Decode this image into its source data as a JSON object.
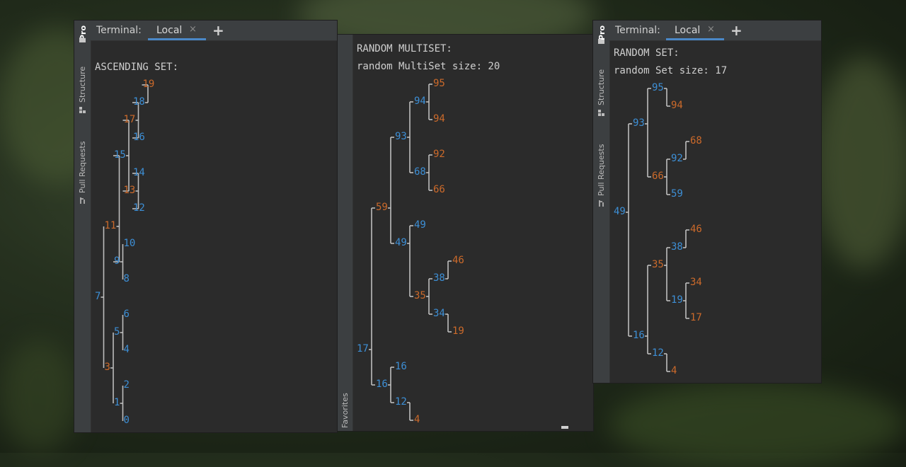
{
  "colors": {
    "orange": "#cc6a2b",
    "blue": "#3d8fd6",
    "text": "#cfcfcf",
    "panel": "#2b2b2b",
    "tabbar": "#3c3f41",
    "accent": "#4a88c7"
  },
  "sidebar": {
    "project": "Pro",
    "structure": "Structure",
    "pull_requests": "Pull Requests",
    "favorites": "Favorites"
  },
  "terminal": {
    "title": "Terminal:",
    "tab_label": "Local",
    "close_glyph": "×",
    "add_glyph": "+"
  },
  "panels": {
    "ascending": {
      "header": "ASCENDING SET:"
    },
    "multiset": {
      "header": "RANDOM MULTISET:",
      "size_line": "random MultiSet size: 20"
    },
    "randomset": {
      "header": "RANDOM SET:",
      "size_line": "random Set size: 17"
    }
  },
  "trees": {
    "ascending": {
      "v": 7,
      "c": "b",
      "L": {
        "v": 3,
        "c": "o",
        "L": {
          "v": 1,
          "c": "b",
          "L": {
            "v": 0,
            "c": "b"
          },
          "R": {
            "v": 2,
            "c": "b"
          }
        },
        "R": {
          "v": 5,
          "c": "b",
          "L": {
            "v": 4,
            "c": "b"
          },
          "R": {
            "v": 6,
            "c": "b"
          }
        }
      },
      "R": {
        "v": 11,
        "c": "o",
        "L": {
          "v": 9,
          "c": "b",
          "L": {
            "v": 8,
            "c": "b"
          },
          "R": {
            "v": 10,
            "c": "b"
          }
        },
        "R": {
          "v": 15,
          "c": "b",
          "L": {
            "v": 13,
            "c": "o",
            "L": {
              "v": 12,
              "c": "b"
            },
            "R": {
              "v": 14,
              "c": "b"
            }
          },
          "R": {
            "v": 17,
            "c": "o",
            "L": {
              "v": 16,
              "c": "b"
            },
            "R": {
              "v": 18,
              "c": "b",
              "R": {
                "v": 19,
                "c": "o"
              }
            }
          }
        }
      }
    },
    "multiset": {
      "v": 17,
      "c": "b",
      "L": {
        "v": 16,
        "c": "b",
        "L": {
          "v": 12,
          "c": "b",
          "L": {
            "v": 4,
            "c": "o"
          }
        },
        "R": {
          "v": 16,
          "c": "b"
        }
      },
      "R": {
        "v": 59,
        "c": "o",
        "L": {
          "v": 49,
          "c": "b",
          "L": {
            "v": 35,
            "c": "o",
            "L": {
              "v": 34,
              "c": "b",
              "L": {
                "v": 19,
                "c": "o"
              }
            },
            "R": {
              "v": 38,
              "c": "b",
              "R": {
                "v": 46,
                "c": "o"
              }
            }
          },
          "R": {
            "v": 49,
            "c": "b"
          }
        },
        "R": {
          "v": 93,
          "c": "b",
          "L": {
            "v": 68,
            "c": "b",
            "L": {
              "v": 66,
              "c": "o"
            },
            "R": {
              "v": 92,
              "c": "o"
            }
          },
          "R": {
            "v": 94,
            "c": "b",
            "L": {
              "v": 94,
              "c": "o"
            },
            "R": {
              "v": 95,
              "c": "o"
            }
          }
        }
      }
    },
    "randomset": {
      "v": 49,
      "c": "b",
      "L": {
        "v": 16,
        "c": "b",
        "L": {
          "v": 12,
          "c": "b",
          "L": {
            "v": 4,
            "c": "o"
          }
        },
        "R": {
          "v": 35,
          "c": "o",
          "L": {
            "v": 19,
            "c": "b",
            "L": {
              "v": 17,
              "c": "o"
            },
            "R": {
              "v": 34,
              "c": "o"
            }
          },
          "R": {
            "v": 38,
            "c": "b",
            "R": {
              "v": 46,
              "c": "o"
            }
          }
        }
      },
      "R": {
        "v": 93,
        "c": "b",
        "L": {
          "v": 66,
          "c": "o",
          "L": {
            "v": 59,
            "c": "b"
          },
          "R": {
            "v": 92,
            "c": "b",
            "R": {
              "v": 68,
              "c": "o"
            }
          }
        },
        "R": {
          "v": 95,
          "c": "b",
          "L": {
            "v": 94,
            "c": "o"
          }
        }
      }
    }
  }
}
